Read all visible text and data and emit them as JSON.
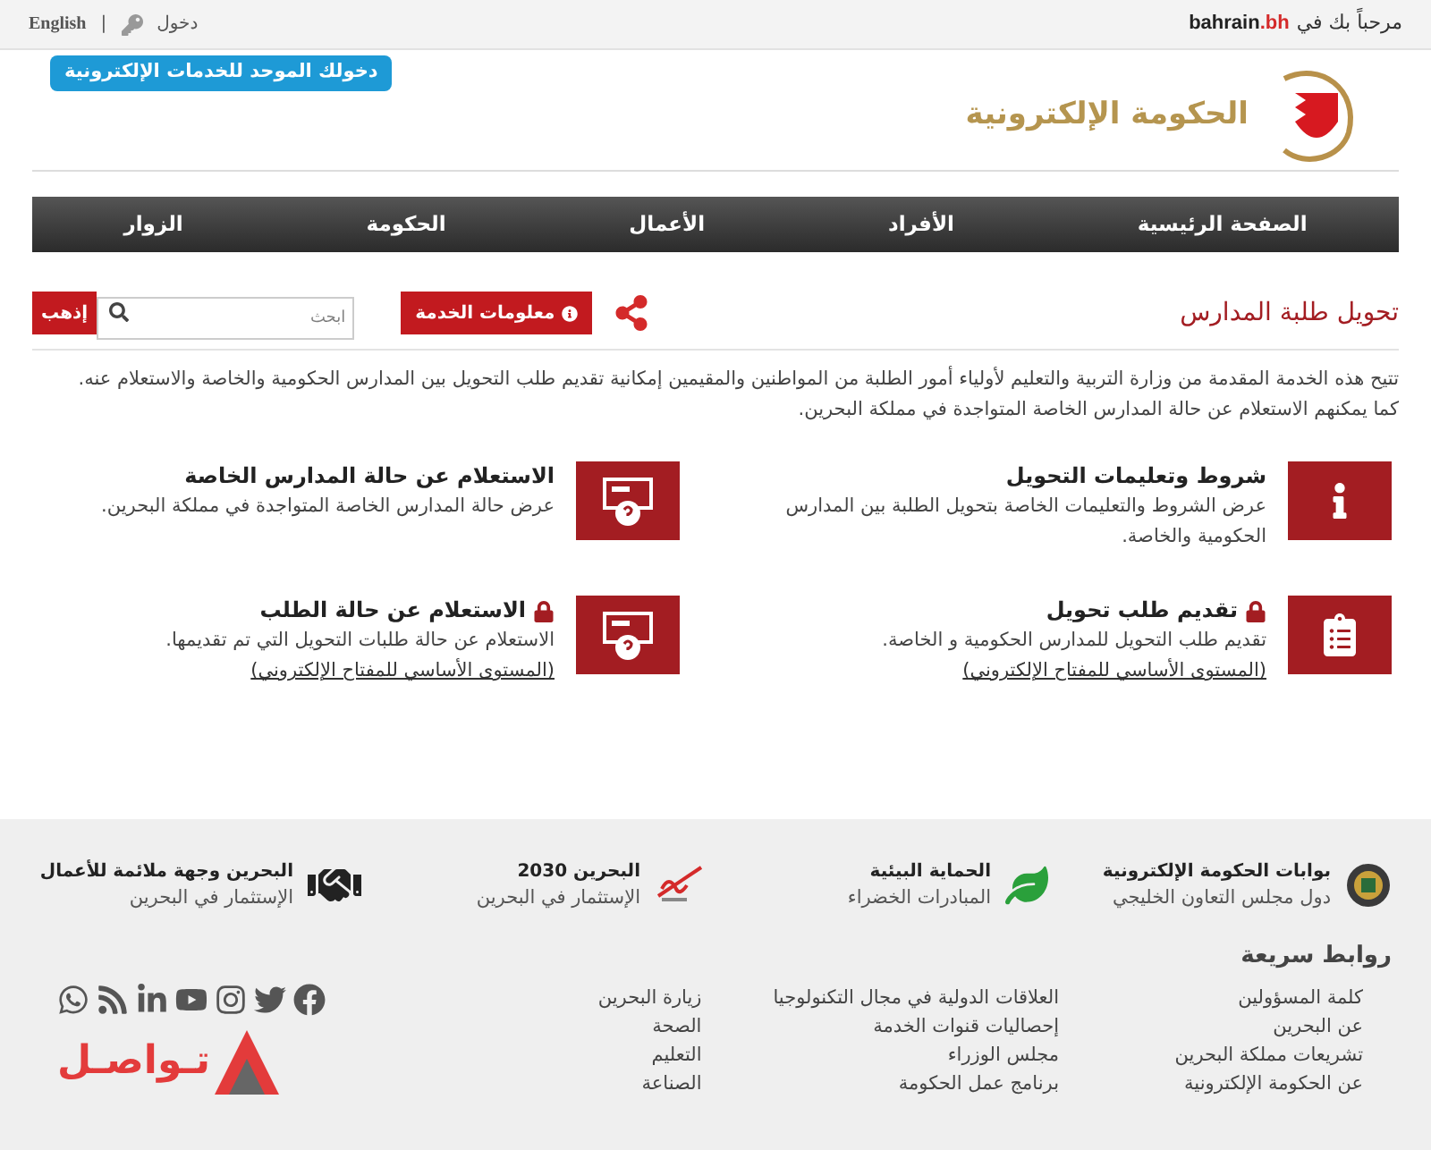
{
  "top_bar": {
    "welcome": "مرحباً بك في",
    "site_name": "bahrain",
    "site_suffix": ".bh",
    "login": "دخول",
    "separator": "|",
    "language": "English"
  },
  "login_tooltip": "دخولك الموحد للخدمات الإلكترونية",
  "logo_text": "الحكومة الإلكترونية",
  "nav": [
    "الصفحة الرئيسية",
    "الأفراد",
    "الأعمال",
    "الحكومة",
    "الزوار"
  ],
  "page": {
    "title": "تحويل طلبة المدارس",
    "info_button": "معلومات الخدمة",
    "search": {
      "placeholder": "ابحث"
    },
    "go_button": "إذهب",
    "description": [
      "تتيح هذه الخدمة المقدمة من وزارة التربية والتعليم لأولياء أمور الطلبة من المواطنين والمقيمين إمكانية تقديم طلب التحويل بين المدارس الحكومية والخاصة والاستعلام عنه.",
      "كما يمكنهم الاستعلام عن حالة المدارس الخاصة المتواجدة في مملكة البحرين."
    ]
  },
  "services": [
    {
      "kind": "info",
      "locked": false,
      "title": "شروط وتعليمات التحويل",
      "description": "عرض الشروط والتعليمات الخاصة بتحويل الطلبة بين المدارس الحكومية والخاصة."
    },
    {
      "kind": "query",
      "locked": false,
      "title": "الاستعلام عن حالة المدارس الخاصة",
      "description": "عرض حالة المدارس الخاصة المتواجدة في مملكة البحرين."
    },
    {
      "kind": "form",
      "locked": true,
      "title": "تقديم طلب تحويل",
      "description": "تقديم طلب التحويل للمدارس الحكومية و الخاصة.",
      "link": "(المستوى الأساسي للمفتاح الإلكتروني)"
    },
    {
      "kind": "query",
      "locked": true,
      "title": "الاستعلام عن حالة الطلب",
      "description": "الاستعلام عن حالة طلبات التحويل التي تم تقديمها.",
      "link": "(المستوى الأساسي للمفتاح الإلكتروني)"
    }
  ],
  "footer": {
    "portals": [
      {
        "kind": "emblem",
        "title": "بوابات الحكومة الإلكترونية",
        "subtitle": "دول مجلس التعاون الخليجي"
      },
      {
        "kind": "leaf",
        "title": "الحماية البيئية",
        "subtitle": "المبادرات الخضراء"
      },
      {
        "kind": "vision",
        "title": "البحرين 2030",
        "subtitle": "الإستثمار في البحرين"
      },
      {
        "kind": "handshake",
        "title": "البحرين وجهة ملائمة للأعمال",
        "subtitle": "الإستثمار في البحرين"
      }
    ],
    "quick_links_title": "روابط سريعة",
    "link_columns": [
      [
        "كلمة المسؤولين",
        "عن البحرين",
        "تشريعات مملكة البحرين",
        "عن الحكومة الإلكترونية"
      ],
      [
        "العلاقات الدولية في مجال التكنولوجيا",
        "إحصاليات قنوات الخدمة",
        "مجلس الوزراء",
        "برنامج عمل الحكومة"
      ],
      [
        "زيارة البحرين",
        "الصحة",
        "التعليم",
        "الصناعة"
      ]
    ],
    "tawasul": "تـواصـل"
  }
}
